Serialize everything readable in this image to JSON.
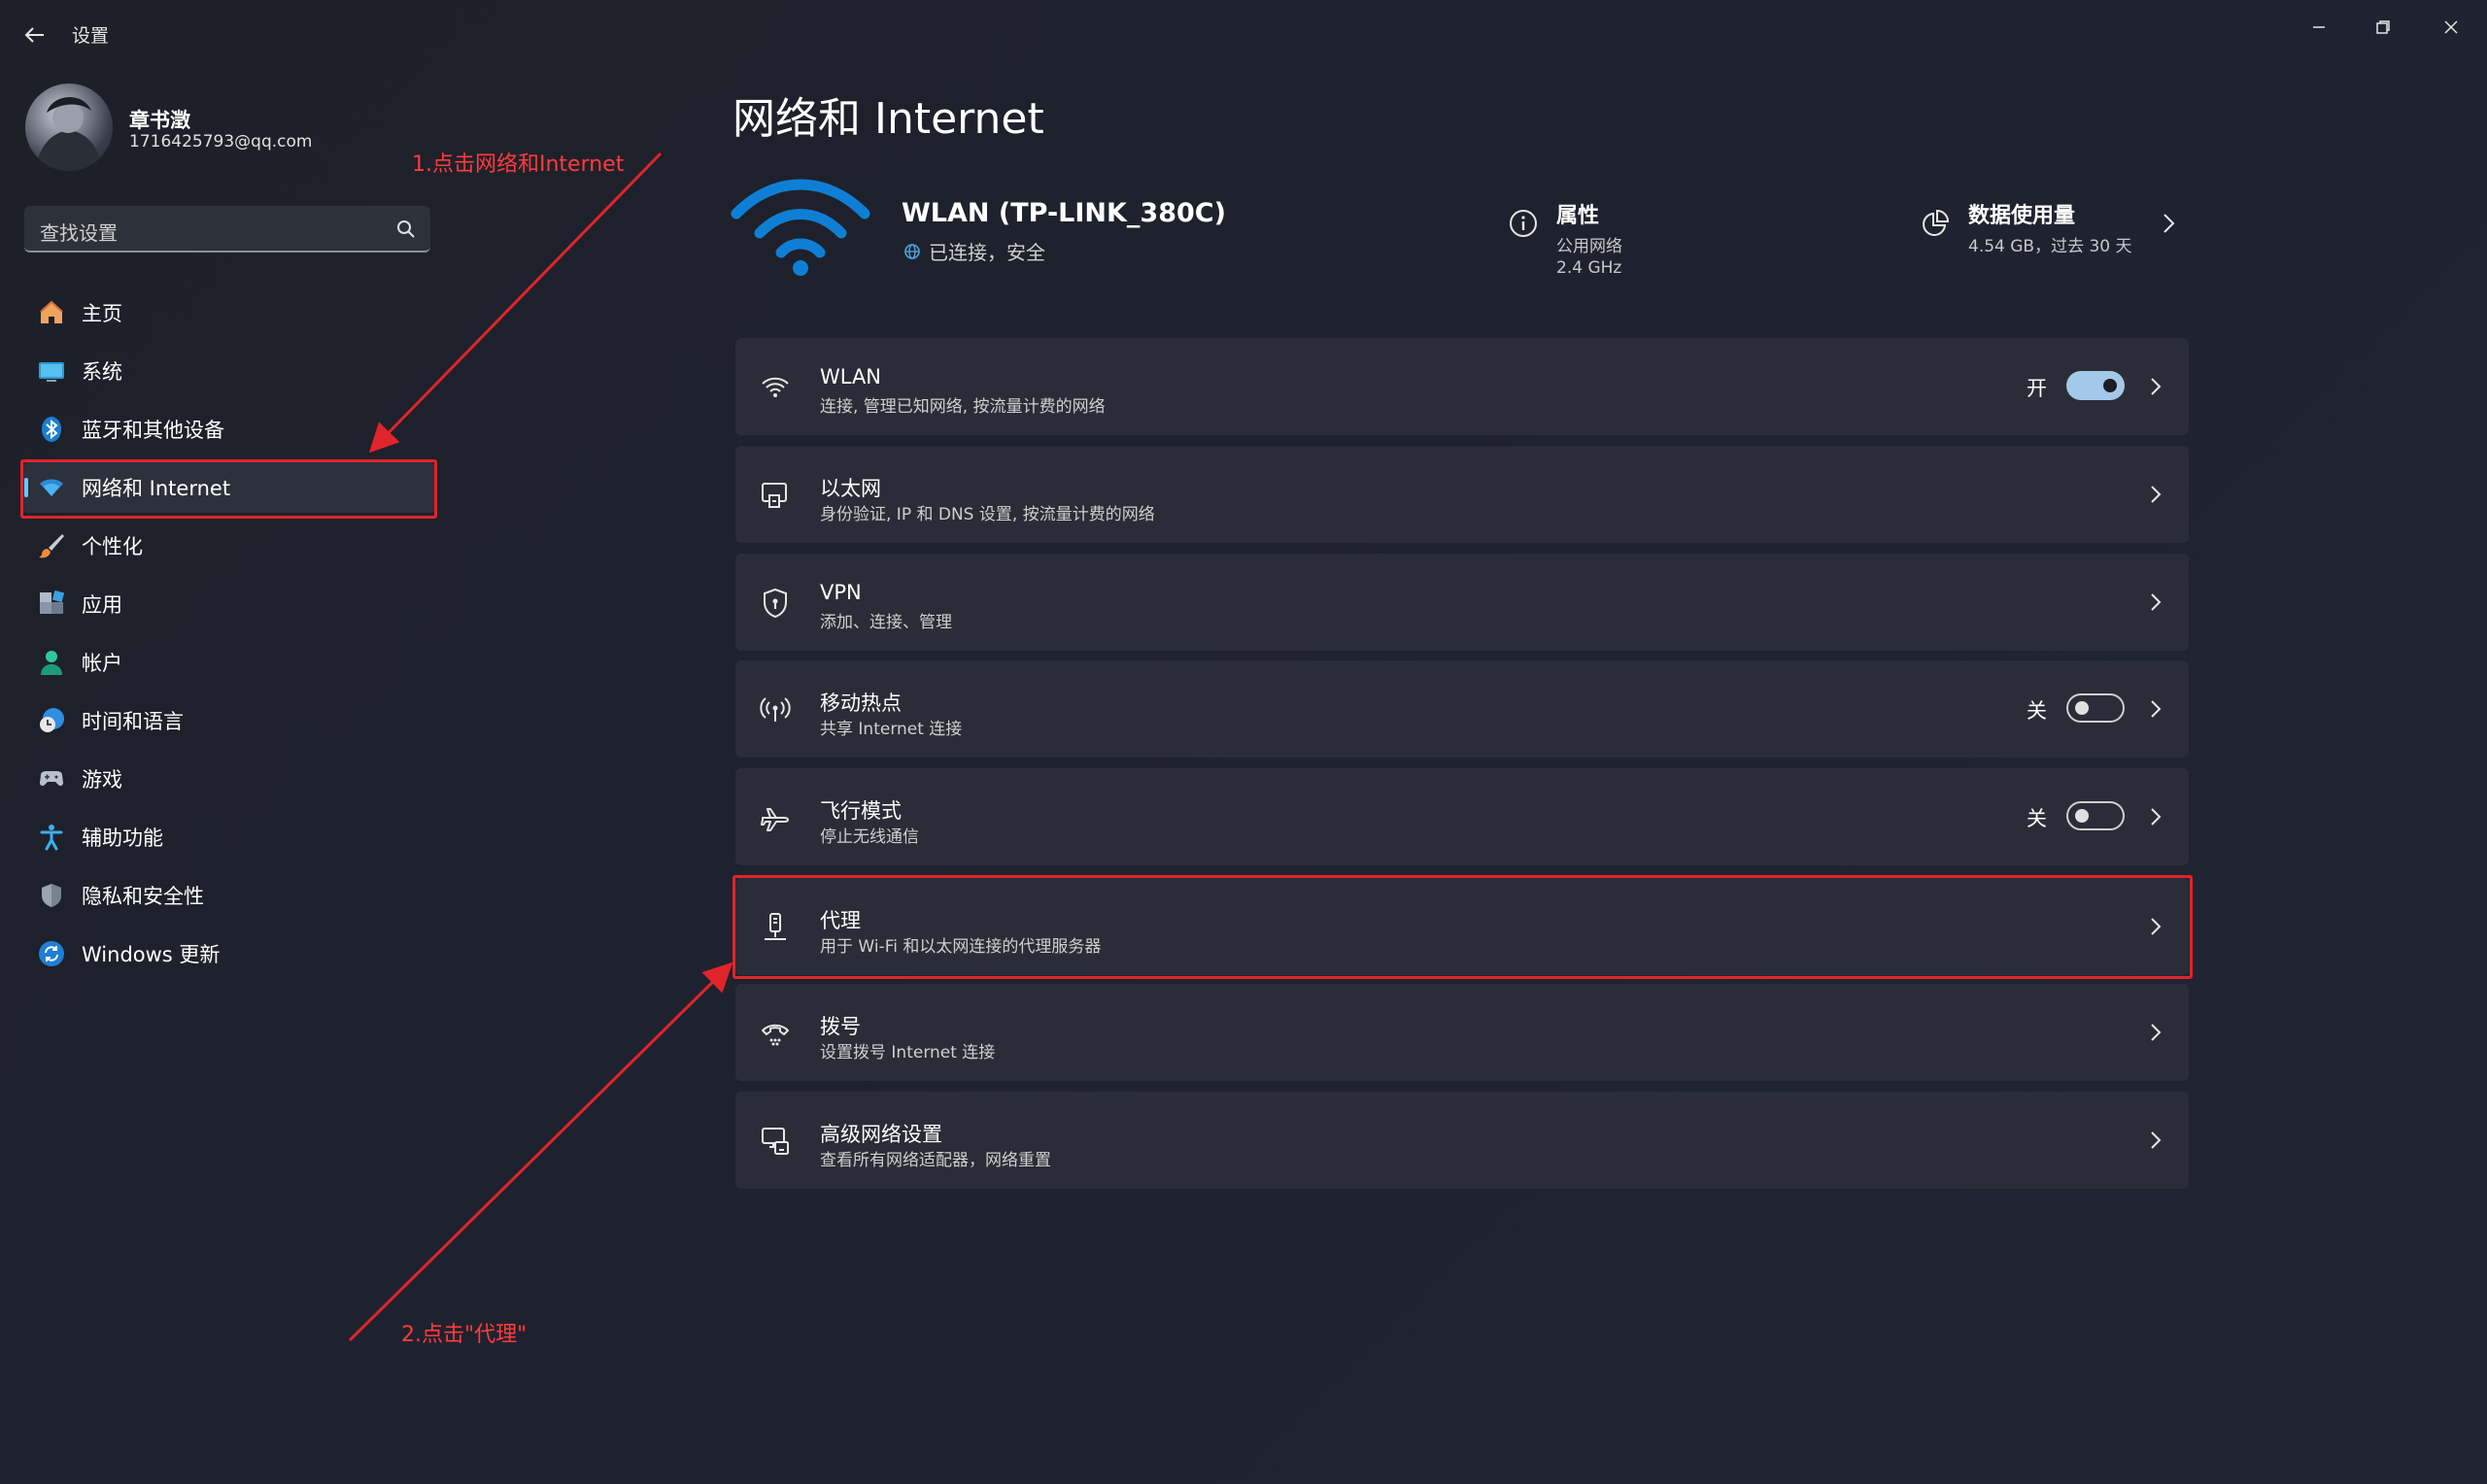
{
  "window": {
    "title": "设置"
  },
  "user": {
    "name": "章书澂",
    "email": "1716425793@qq.com"
  },
  "search": {
    "placeholder": "查找设置"
  },
  "sidebar": {
    "items": [
      {
        "label": "主页",
        "icon": "home-icon"
      },
      {
        "label": "系统",
        "icon": "system-icon"
      },
      {
        "label": "蓝牙和其他设备",
        "icon": "bluetooth-icon"
      },
      {
        "label": "网络和 Internet",
        "icon": "network-icon",
        "active": true
      },
      {
        "label": "个性化",
        "icon": "brush-icon"
      },
      {
        "label": "应用",
        "icon": "apps-icon"
      },
      {
        "label": "帐户",
        "icon": "account-icon"
      },
      {
        "label": "时间和语言",
        "icon": "clock-globe-icon"
      },
      {
        "label": "游戏",
        "icon": "gamepad-icon"
      },
      {
        "label": "辅助功能",
        "icon": "accessibility-icon"
      },
      {
        "label": "隐私和安全性",
        "icon": "shield-icon"
      },
      {
        "label": "Windows 更新",
        "icon": "update-icon"
      }
    ]
  },
  "page": {
    "title": "网络和 Internet"
  },
  "hero": {
    "network_name": "WLAN (TP-LINK_380C)",
    "status": "已连接，安全",
    "properties_label": "属性",
    "properties_sub1": "公用网络",
    "properties_sub2": "2.4 GHz",
    "usage_label": "数据使用量",
    "usage_sub": "4.54 GB，过去 30 天"
  },
  "cards": [
    {
      "title": "WLAN",
      "subtitle": "连接, 管理已知网络, 按流量计费的网络",
      "icon": "wifi-icon",
      "toggle_state": "开",
      "toggle_on": true
    },
    {
      "title": "以太网",
      "subtitle": "身份验证, IP 和 DNS 设置, 按流量计费的网络",
      "icon": "ethernet-icon"
    },
    {
      "title": "VPN",
      "subtitle": "添加、连接、管理",
      "icon": "vpn-shield-icon"
    },
    {
      "title": "移动热点",
      "subtitle": "共享 Internet 连接",
      "icon": "hotspot-icon",
      "toggle_state": "关",
      "toggle_on": false
    },
    {
      "title": "飞行模式",
      "subtitle": "停止无线通信",
      "icon": "airplane-icon",
      "toggle_state": "关",
      "toggle_on": false
    },
    {
      "title": "代理",
      "subtitle": "用于 Wi-Fi 和以太网连接的代理服务器",
      "icon": "proxy-icon"
    },
    {
      "title": "拨号",
      "subtitle": "设置拨号 Internet 连接",
      "icon": "dialup-icon"
    },
    {
      "title": "高级网络设置",
      "subtitle": "查看所有网络适配器，网络重置",
      "icon": "advanced-network-icon"
    }
  ],
  "annotations": {
    "step1": "1.点击网络和Internet",
    "step2": "2.点击\"代理\""
  },
  "colors": {
    "accent": "#60cdff",
    "annotation": "#e0242b",
    "wifi_blue": "#0f7fd6"
  }
}
